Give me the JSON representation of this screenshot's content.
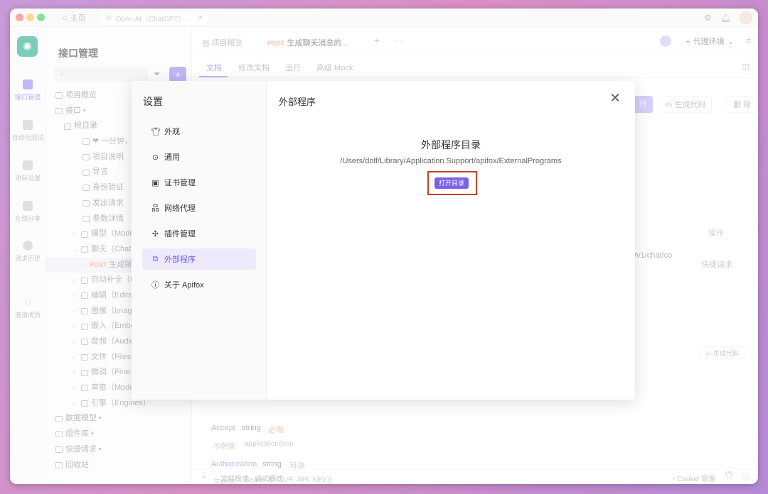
{
  "titlebar": {
    "home_tab": "主页",
    "active_tab": "Open AI（ChatGPT）官..."
  },
  "rail": {
    "items": [
      "接口管理",
      "自动化测试",
      "项目设置",
      "在线分享",
      "请求历史",
      "邀请成员"
    ]
  },
  "sidebar": {
    "title": "接口管理",
    "add_label": "+",
    "tree": [
      "项目概览",
      "接口 •",
      "根目录",
      "❤ 一分钟，了解",
      "项目说明",
      "导言",
      "身份验证",
      "发出请求",
      "参数详情",
      "模型（Models",
      "聊天（Chat）",
      "生成聊天",
      "自动补全（Co",
      "编辑（Edits）",
      "图像（Images",
      "嵌入（Embed",
      "音频（Audio）",
      "文件（Files）",
      "微调（Fine-tu",
      "审查（Modera",
      "引擎（Engines）",
      "数据模型 •",
      "组件库 •",
      "快捷请求 •",
      "回收站"
    ],
    "post_tag": "POST"
  },
  "main": {
    "tab_overview": "项目概览",
    "tab_post": "POST",
    "tab_endpoint": "生成聊天消息的...",
    "tab_add": "+",
    "tab_more": "···",
    "env": "代理环境",
    "subtabs": [
      "文档",
      "修改文档",
      "运行",
      "高级 Mock"
    ],
    "run_label": "行",
    "generate_code": "生成代码",
    "delete": "删 除",
    "actions_label": "操作",
    "path_fragment": "/v1/chat/co",
    "quick_request": "快捷请求",
    "generate_code_small": "生成代码",
    "param_accept": "Accept",
    "param_string": "string",
    "param_required": "必需",
    "example_label": "示例值:",
    "example_accept": "application/json",
    "param_auth": "Authorization",
    "param_optional": "可选",
    "example_auth": "Bearer {{YOUR_API_KEY}}",
    "bottom_doc_mode": "文档模式",
    "bottom_debug_mode": "调试模式",
    "cookie_manage": "Cookie 管理"
  },
  "modal": {
    "title": "设置",
    "menu": [
      "外观",
      "通用",
      "证书管理",
      "网络代理",
      "插件管理",
      "外部程序",
      "关于 Apifox"
    ],
    "active_index": 5,
    "panel_title": "外部程序",
    "heading": "外部程序目录",
    "path": "/Users/dolf/Library/Application Support/apifox/ExternalPrograms",
    "open_button": "打开目录"
  },
  "colors": {
    "accent": "#8a7cf0",
    "highlight_border": "#c5402a",
    "post": "#f39a6a"
  }
}
